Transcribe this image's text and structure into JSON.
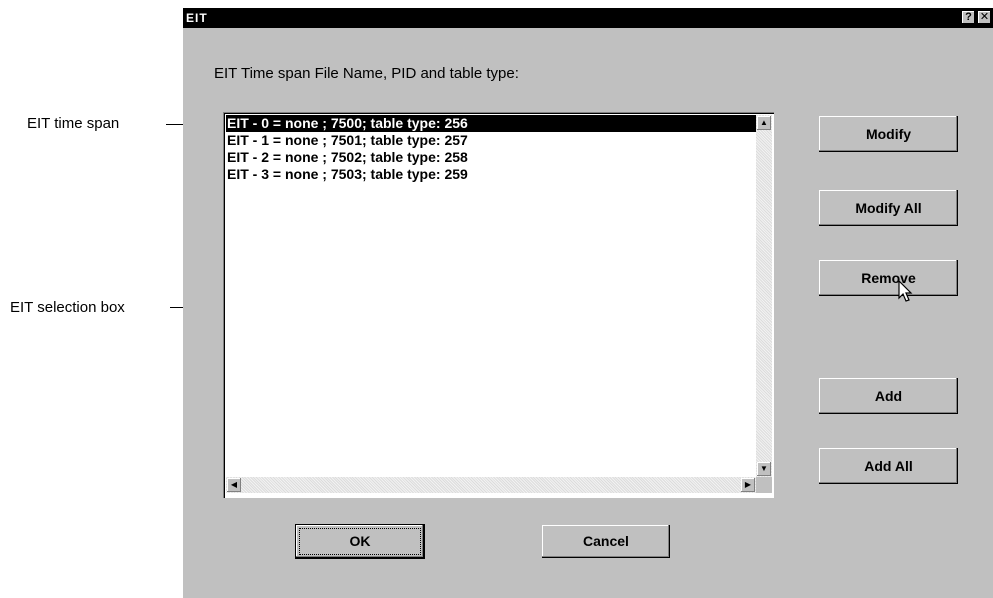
{
  "annotations": {
    "time_span": "EIT time span",
    "selection_box": "EIT selection box"
  },
  "dialog": {
    "title": "EIT",
    "help_label": "?",
    "close_label": "✕",
    "prompt": "EIT Time span File Name, PID and table type:",
    "list_items": [
      "EIT - 0 = none ; 7500; table type: 256",
      "EIT - 1 = none ; 7501; table type: 257",
      "EIT - 2 = none ; 7502; table type: 258",
      "EIT - 3 = none ; 7503; table type: 259"
    ],
    "selected_index": 0,
    "buttons": {
      "modify": "Modify",
      "modify_all": "Modify All",
      "remove": "Remove",
      "add": "Add",
      "add_all": "Add All",
      "ok": "OK",
      "cancel": "Cancel"
    }
  },
  "icons": {
    "scroll_up": "▲",
    "scroll_down": "▼",
    "scroll_left": "◀",
    "scroll_right": "▶"
  }
}
